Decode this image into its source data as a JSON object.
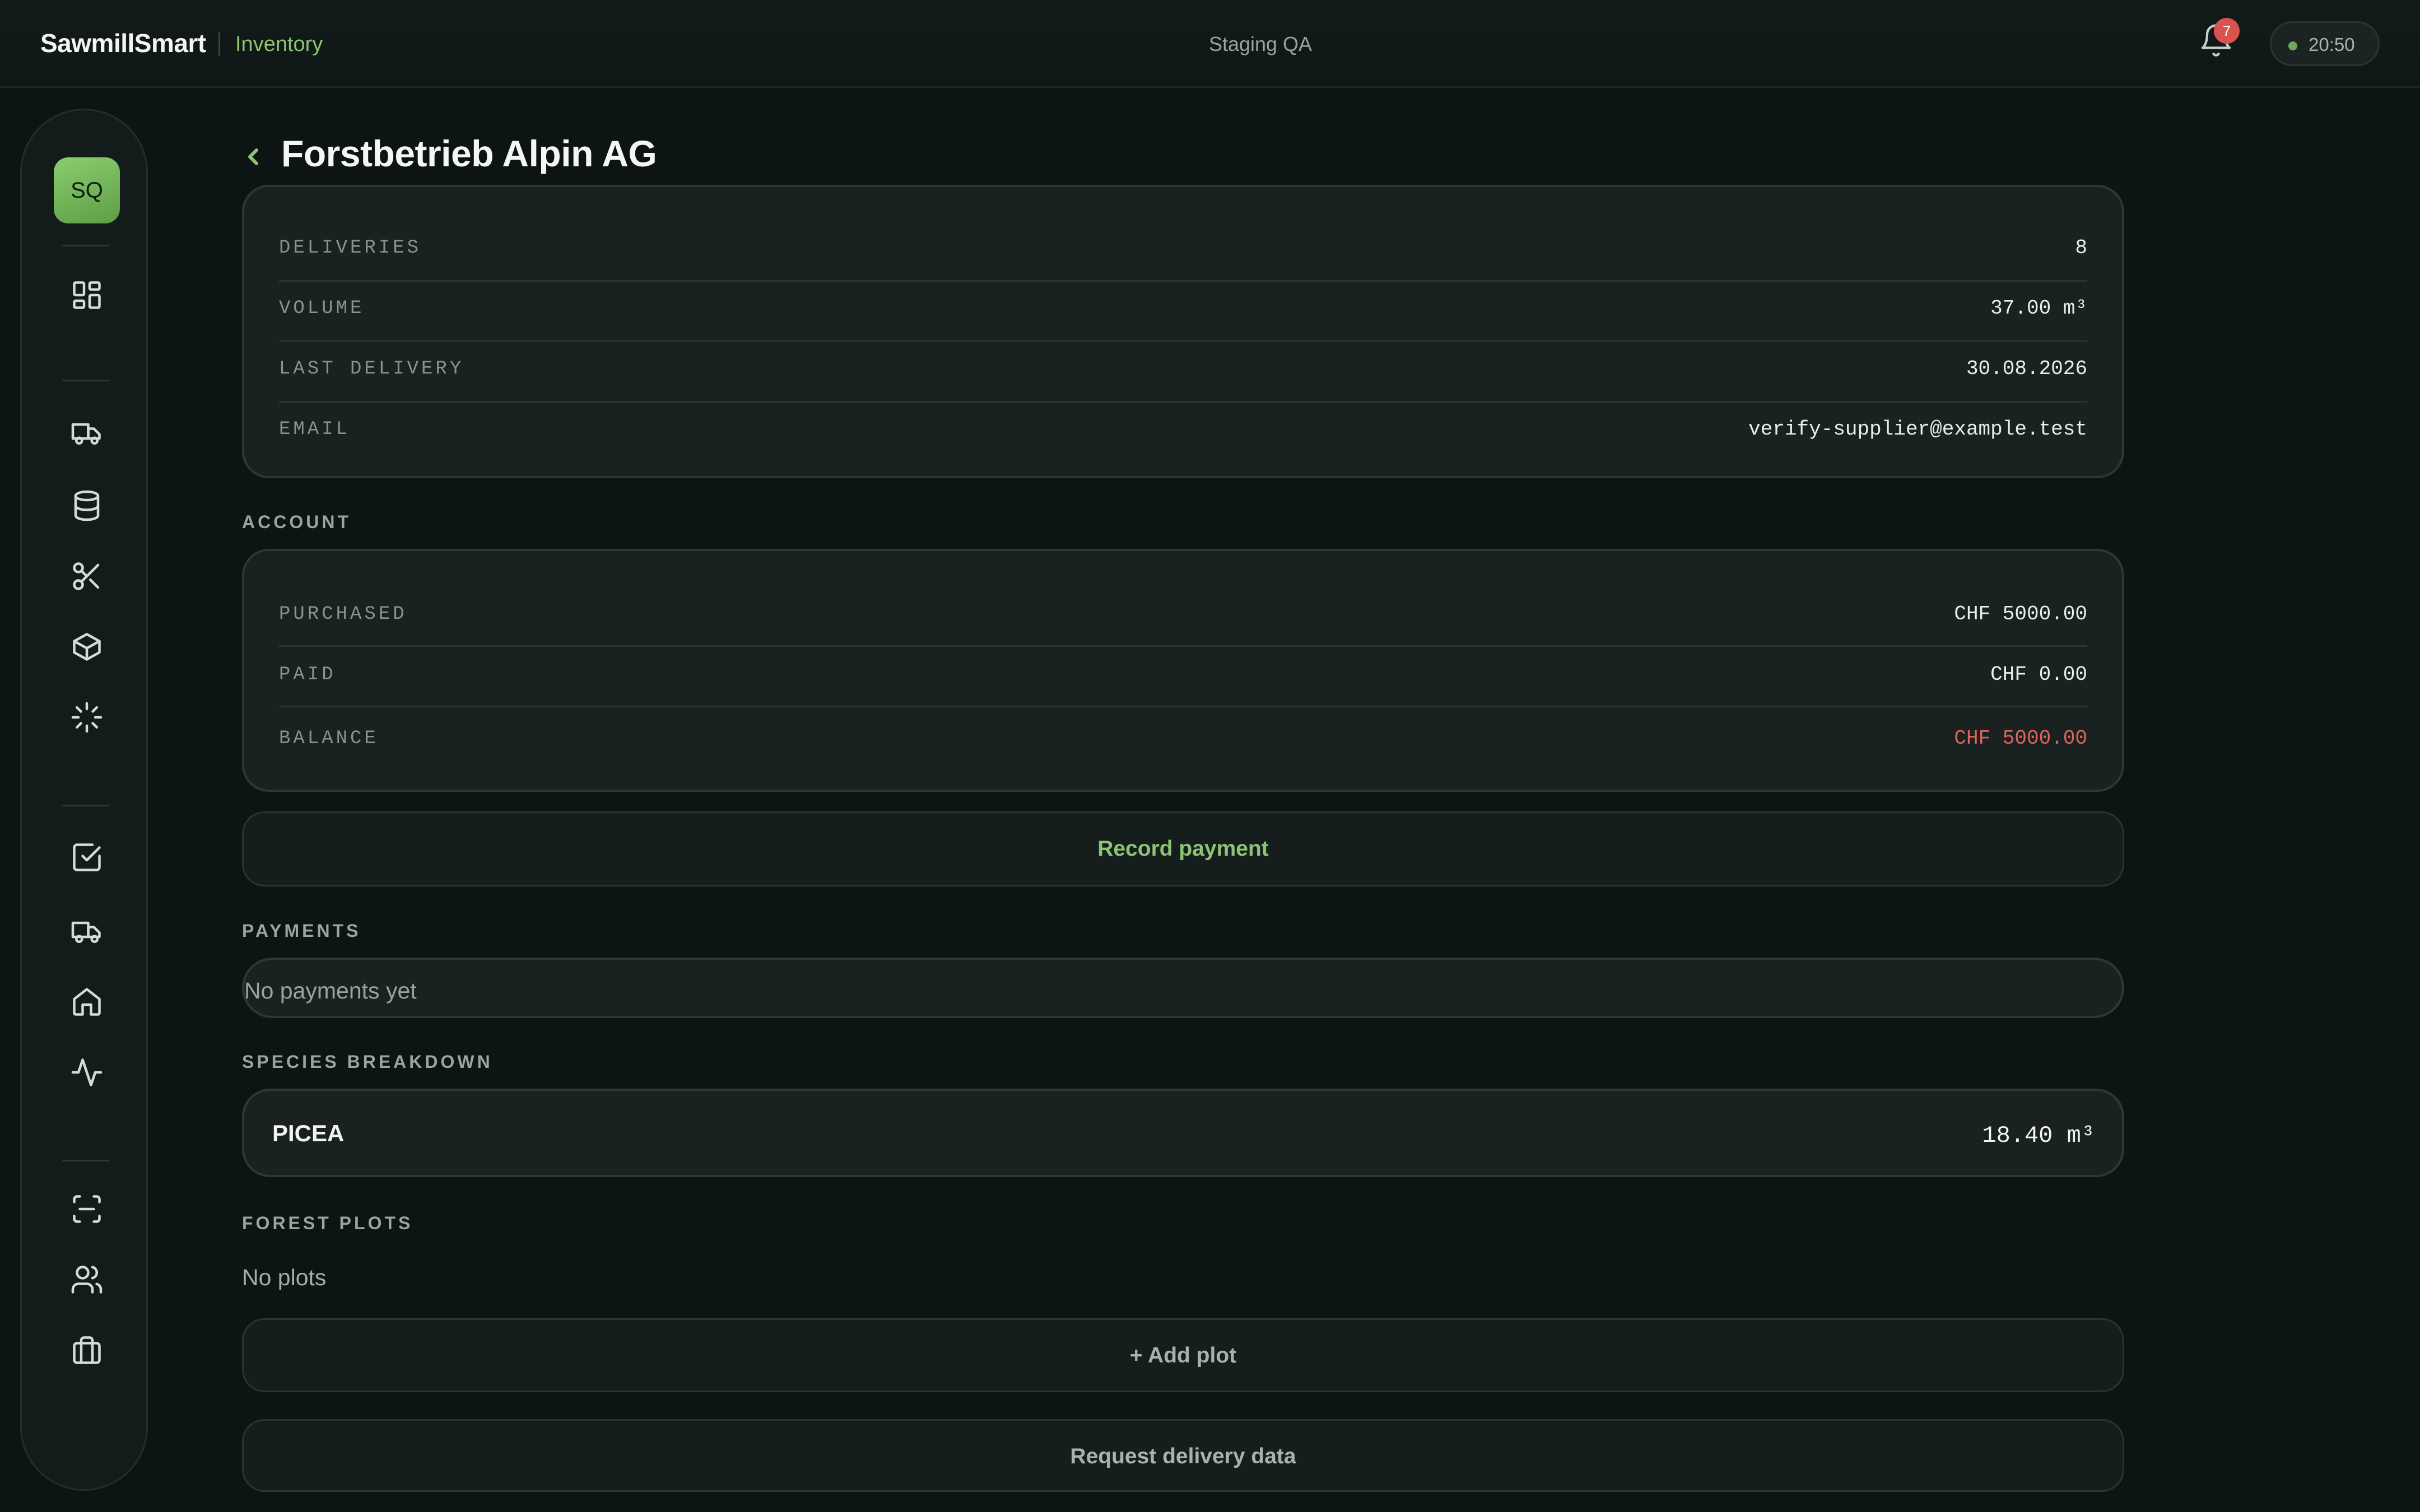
{
  "app": {
    "brand": "SawmillSmart",
    "section": "Inventory",
    "environment": "Staging QA"
  },
  "header": {
    "notification_count": "7",
    "clock": "20:50"
  },
  "sidebar": {
    "avatar_initials": "SQ",
    "icons": [
      "dashboard-icon",
      "truck-icon",
      "database-icon",
      "scissors-icon",
      "box-icon",
      "loader-icon",
      "checkbox-icon",
      "truck-icon",
      "home-icon",
      "activity-icon",
      "scan-icon",
      "users-icon",
      "briefcase-icon"
    ]
  },
  "page": {
    "title": "Forstbetrieb Alpin AG"
  },
  "summary": {
    "rows": [
      {
        "label": "DELIVERIES",
        "value": "8"
      },
      {
        "label": "VOLUME",
        "value": "37.00 m³"
      },
      {
        "label": "LAST DELIVERY",
        "value": "30.08.2026"
      },
      {
        "label": "EMAIL",
        "value": "verify-supplier@example.test"
      }
    ]
  },
  "account": {
    "heading": "ACCOUNT",
    "rows": [
      {
        "label": "PURCHASED",
        "value": "CHF 5000.00"
      },
      {
        "label": "PAID",
        "value": "CHF 0.00"
      },
      {
        "label": "BALANCE",
        "value": "CHF 5000.00"
      }
    ],
    "balance_color": "#e0635b",
    "record_payment_label": "Record payment"
  },
  "payments": {
    "heading": "PAYMENTS",
    "empty_text": "No payments yet"
  },
  "species": {
    "heading": "SPECIES BREAKDOWN",
    "items": [
      {
        "name": "PICEA",
        "volume": "18.40 m³"
      }
    ]
  },
  "plots": {
    "heading": "FOREST PLOTS",
    "empty_text": "No plots",
    "add_label": "+ Add plot",
    "request_label": "Request delivery data"
  },
  "colors": {
    "accent": "#8cc474",
    "danger": "#e0635b",
    "background": "#0d1514"
  }
}
